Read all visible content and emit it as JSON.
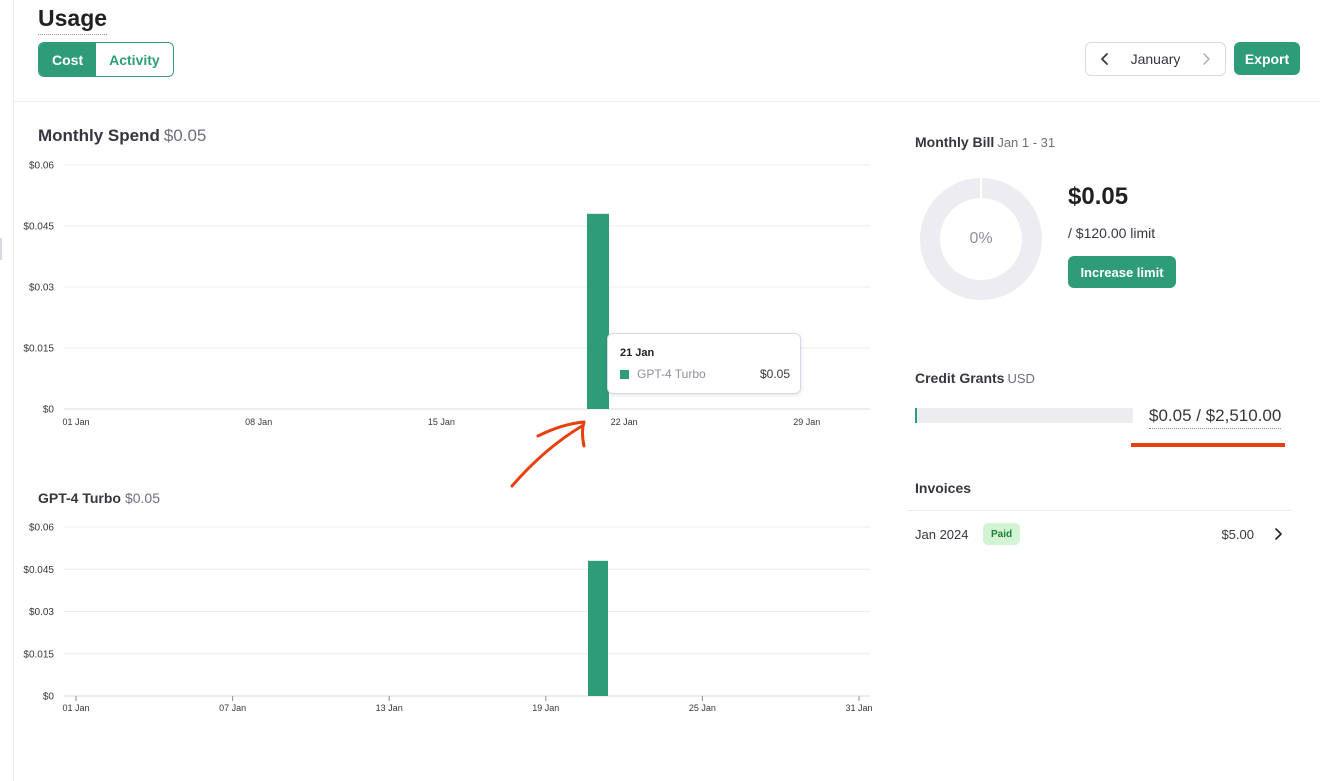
{
  "header": {
    "title": "Usage",
    "tabs": [
      {
        "label": "Cost",
        "active": true
      },
      {
        "label": "Activity",
        "active": false
      }
    ],
    "month": "January",
    "export_label": "Export"
  },
  "monthly_spend": {
    "title": "Monthly Spend",
    "amount": "$0.05",
    "tooltip": {
      "date": "21 Jan",
      "series": "GPT-4 Turbo",
      "value": "$0.05"
    }
  },
  "model_chart": {
    "title": "GPT-4 Turbo",
    "amount": "$0.05"
  },
  "chart_data": [
    {
      "type": "bar",
      "title": "Monthly Spend",
      "series": [
        {
          "name": "GPT-4 Turbo",
          "values": [
            {
              "x": "21 Jan",
              "y": 0.048
            }
          ]
        }
      ],
      "x_range": [
        1,
        31
      ],
      "x_ticks": [
        {
          "day": 1,
          "label": "01 Jan"
        },
        {
          "day": 8,
          "label": "08 Jan"
        },
        {
          "day": 15,
          "label": "15 Jan"
        },
        {
          "day": 22,
          "label": "22 Jan"
        },
        {
          "day": 29,
          "label": "29 Jan"
        }
      ],
      "bars": [
        {
          "day": 21,
          "value": 0.048
        }
      ],
      "ylim": [
        0,
        0.06
      ],
      "y_ticks": [
        {
          "value": 0,
          "label": "$0"
        },
        {
          "value": 0.015,
          "label": "$0.015"
        },
        {
          "value": 0.03,
          "label": "$0.03"
        },
        {
          "value": 0.045,
          "label": "$0.045"
        },
        {
          "value": 0.06,
          "label": "$0.06"
        }
      ],
      "grid": true
    },
    {
      "type": "bar",
      "title": "GPT-4 Turbo",
      "x_range": [
        1,
        31
      ],
      "x_ticks": [
        {
          "day": 1,
          "label": "01 Jan"
        },
        {
          "day": 7,
          "label": "07 Jan"
        },
        {
          "day": 13,
          "label": "13 Jan"
        },
        {
          "day": 19,
          "label": "19 Jan"
        },
        {
          "day": 25,
          "label": "25 Jan"
        },
        {
          "day": 31,
          "label": "31 Jan"
        }
      ],
      "bars": [
        {
          "day": 21,
          "value": 0.048
        }
      ],
      "ylim": [
        0,
        0.06
      ],
      "y_ticks": [
        {
          "value": 0,
          "label": "$0"
        },
        {
          "value": 0.015,
          "label": "$0.015"
        },
        {
          "value": 0.03,
          "label": "$0.03"
        },
        {
          "value": 0.045,
          "label": "$0.045"
        },
        {
          "value": 0.06,
          "label": "$0.06"
        }
      ],
      "grid": true
    }
  ],
  "monthly_bill": {
    "title": "Monthly Bill",
    "range": "Jan 1 - 31",
    "percent_label": "0%",
    "percent_used": 0,
    "amount": "$0.05",
    "limit": "/ $120.00 limit",
    "increase_label": "Increase limit"
  },
  "credit_grants": {
    "title": "Credit Grants",
    "currency": "USD",
    "used_fraction": 2e-05,
    "amount": "$0.05 / $2,510.00"
  },
  "invoices": {
    "title": "Invoices",
    "items": [
      {
        "date": "Jan 2024",
        "status": "Paid",
        "amount": "$5.00"
      }
    ]
  },
  "colors": {
    "accent": "#2f9c79",
    "annotation": "#e8400c",
    "paid_bg": "#d2f4d3",
    "paid_text": "#1a7f37"
  },
  "icons": {
    "prev": "chevron-left-icon",
    "next": "chevron-right-icon",
    "invoice_open": "chevron-right-icon"
  }
}
